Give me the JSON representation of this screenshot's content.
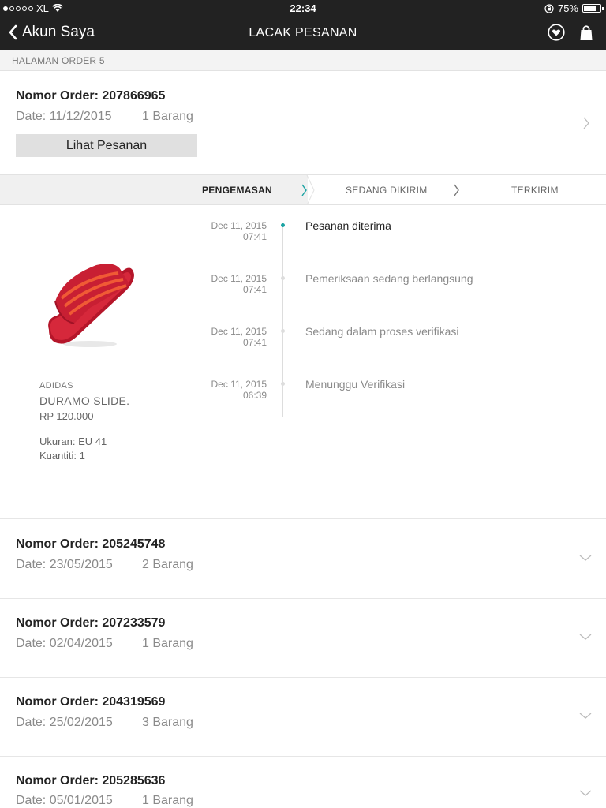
{
  "status_bar": {
    "carrier": "XL",
    "time": "22:34",
    "battery": "75%",
    "battery_level": 0.75
  },
  "nav": {
    "back_label": "Akun Saya",
    "title": "LACAK PESANAN",
    "icons": [
      "heart-icon",
      "shopping-bag-icon"
    ]
  },
  "subheader": "HALAMAN ORDER 5",
  "expanded_order": {
    "title": "Nomor Order: 207866965",
    "date": "Date: 11/12/2015",
    "items": "1 Barang",
    "view_button": "Lihat Pesanan",
    "steps": [
      "PENGEMASAN",
      "SEDANG DIKIRIM",
      "TERKIRIM"
    ],
    "active_step": 0,
    "product": {
      "brand": "ADIDAS",
      "name": "DURAMO SLIDE.",
      "price": "RP 120.000",
      "size": "Ukuran: EU 41",
      "quantity": "Kuantiti: 1",
      "color": "#d6283b"
    },
    "timeline": [
      {
        "date": "Dec 11, 2015",
        "time": "07:41",
        "text": "Pesanan diterima",
        "active": true
      },
      {
        "date": "Dec 11, 2015",
        "time": "07:41",
        "text": "Pemeriksaan sedang berlangsung",
        "active": false
      },
      {
        "date": "Dec 11, 2015",
        "time": "07:41",
        "text": "Sedang dalam proses verifikasi",
        "active": false
      },
      {
        "date": "Dec 11, 2015",
        "time": "06:39",
        "text": "Menunggu Verifikasi",
        "active": false
      }
    ]
  },
  "orders": [
    {
      "title": "Nomor Order: 205245748",
      "date": "Date: 23/05/2015",
      "items": "2 Barang"
    },
    {
      "title": "Nomor Order: 207233579",
      "date": "Date: 02/04/2015",
      "items": "1 Barang"
    },
    {
      "title": "Nomor Order: 204319569",
      "date": "Date: 25/02/2015",
      "items": "3 Barang"
    },
    {
      "title": "Nomor Order: 205285636",
      "date": "Date: 05/01/2015",
      "items": "1 Barang"
    }
  ],
  "colors": {
    "bar_bg": "#222222",
    "accent": "#1aa3a3"
  }
}
